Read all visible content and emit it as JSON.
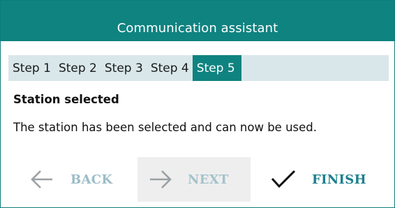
{
  "window": {
    "title": "Communication assistant"
  },
  "steps": [
    {
      "label": "Step 1",
      "active": false
    },
    {
      "label": "Step 2",
      "active": false
    },
    {
      "label": "Step 3",
      "active": false
    },
    {
      "label": "Step 4",
      "active": false
    },
    {
      "label": "Step 5",
      "active": true
    }
  ],
  "content": {
    "heading": "Station selected",
    "message": "The station has been selected and can now be used."
  },
  "buttons": {
    "back": {
      "label": "BACK",
      "icon": "arrow-left-icon",
      "enabled": false
    },
    "next": {
      "label": "NEXT",
      "icon": "arrow-right-icon",
      "enabled": false
    },
    "finish": {
      "label": "FINISH",
      "icon": "checkmark-icon",
      "enabled": true
    }
  },
  "colors": {
    "accent": "#0f8380",
    "step_bar": "#d9e7ea",
    "disabled_text": "#9bbcc8",
    "finish_text": "#1b7f8c"
  }
}
